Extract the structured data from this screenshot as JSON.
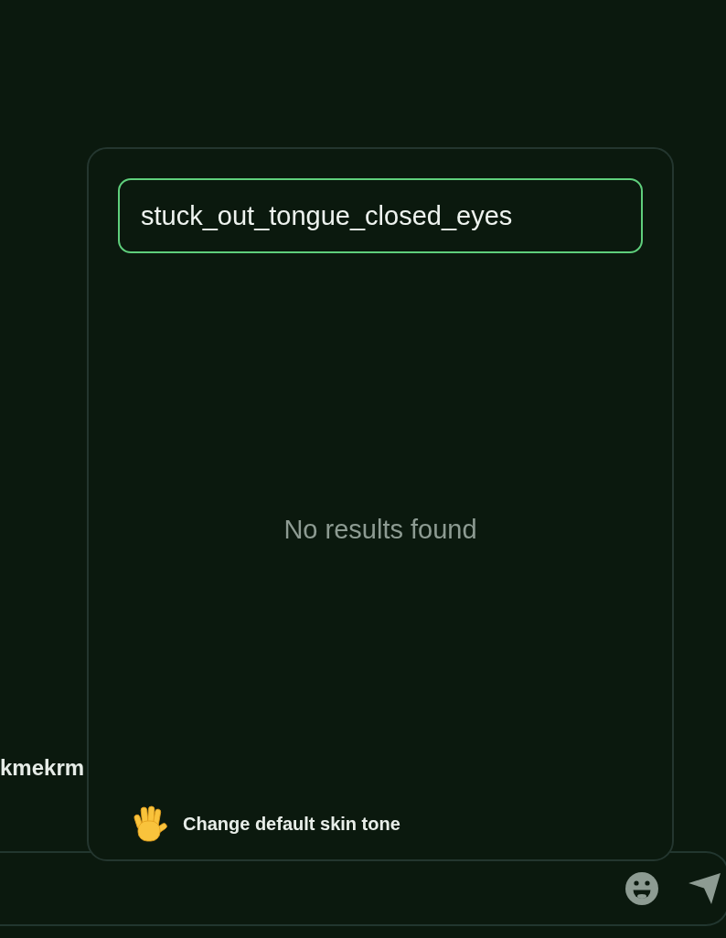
{
  "chat": {
    "sender_name": "kmekrm"
  },
  "emoji_picker": {
    "search": {
      "value": "stuck_out_tongue_closed_eyes"
    },
    "empty_message": "No results found",
    "skin_tone_button": {
      "label": "Change default skin tone"
    }
  }
}
